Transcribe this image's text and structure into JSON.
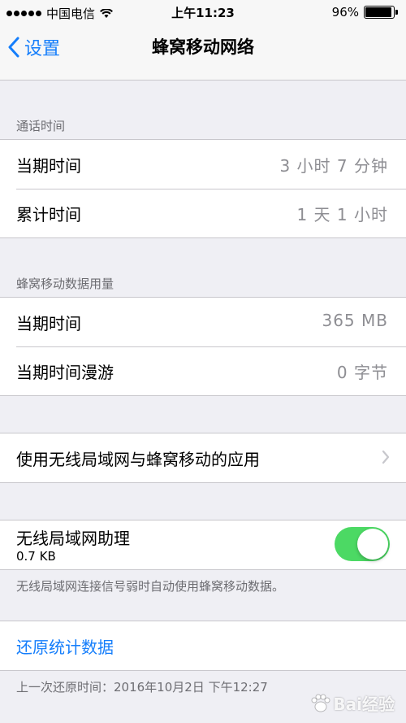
{
  "status_bar": {
    "carrier": "中国电信",
    "time": "上午11:23",
    "battery_text": "96%",
    "battery_level": 0.96
  },
  "nav": {
    "back_label": "设置",
    "title": "蜂窝移动网络"
  },
  "call_time": {
    "header": "通话时间",
    "rows": [
      {
        "label": "当期时间",
        "value": "3 小时 7 分钟"
      },
      {
        "label": "累计时间",
        "value": "1 天 1 小时"
      }
    ]
  },
  "cellular_data": {
    "header": "蜂窝移动数据用量",
    "rows": [
      {
        "label": "当期时间",
        "value": "365 MB"
      },
      {
        "label": "当期时间漫游",
        "value": "0 字节"
      }
    ]
  },
  "apps_row": {
    "label": "使用无线局域网与蜂窝移动的应用"
  },
  "wifi_assist": {
    "label": "无线局域网助理",
    "sublabel": "0.7 KB",
    "enabled": true,
    "footer": "无线局域网连接信号弱时自动使用蜂窝移动数据。"
  },
  "reset": {
    "label": "还原统计数据",
    "footer": "上一次还原时间：2016年10月2日 下午12:27"
  },
  "watermark": {
    "text": "Bai经验"
  },
  "colors": {
    "accent": "#157efb",
    "toggle_on": "#4cd964",
    "background": "#efeff4"
  }
}
